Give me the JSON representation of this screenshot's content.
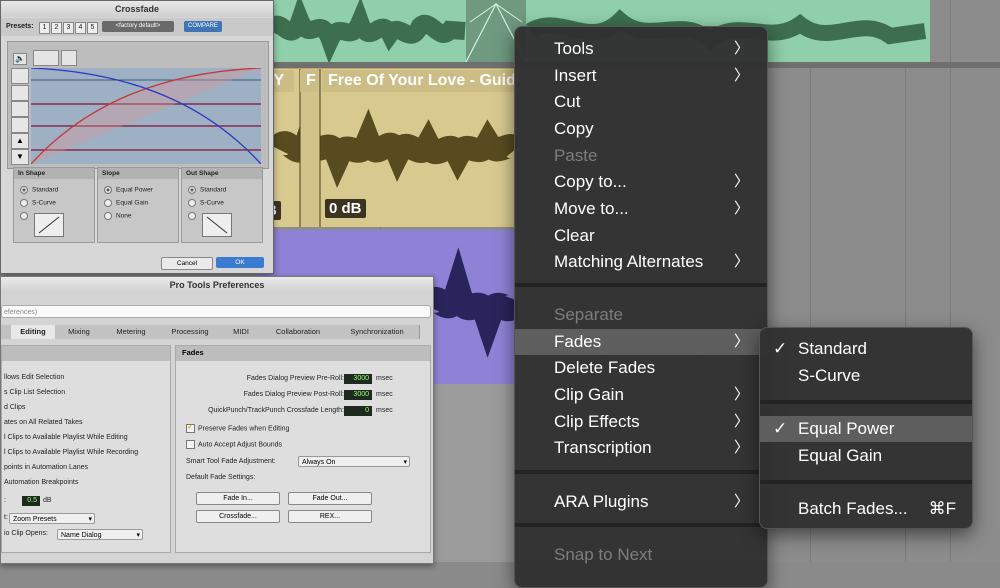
{
  "crossfade": {
    "title": "Crossfade",
    "presets_label": "Presets:",
    "preset_numbers": [
      "1",
      "2",
      "3",
      "4",
      "5"
    ],
    "preset_field": "<factory default>",
    "compare": "COMPARE",
    "in_shape": {
      "title": "In Shape",
      "options": [
        "Standard",
        "S-Curve"
      ],
      "selected": "Standard"
    },
    "slope": {
      "title": "Slope",
      "options": [
        "Equal Power",
        "Equal Gain",
        "None"
      ],
      "selected": "Equal Power"
    },
    "out_shape": {
      "title": "Out Shape",
      "options": [
        "Standard",
        "S-Curve"
      ],
      "selected": "Standard"
    },
    "cancel": "Cancel",
    "ok": "OK"
  },
  "timeline": {
    "clip_title_partial": "f Y",
    "clip_marker": "F",
    "clip_title": "Free Of Your Love - Guid",
    "gain_label": "0 dB",
    "gain_partial": "B"
  },
  "prefs": {
    "title": "Pro Tools Preferences",
    "search_placeholder": "eferences)",
    "tabs": [
      "Editing",
      "Mixing",
      "Metering",
      "Processing",
      "MIDI",
      "Collaboration",
      "Synchronization"
    ],
    "active_tab": "Editing",
    "left_items": [
      "llows Edit Selection",
      "s Clip List Selection",
      "d Clips",
      "ates on All Related Takes",
      "l Clips to Available Playlist While Editing",
      "l Clips to Available Playlist While Recording",
      "points in Automation Lanes",
      "Automation Breakpoints"
    ],
    "left_num_label": ":",
    "left_num_value": "0.5",
    "left_num_unit": "dB",
    "left_select1_label": "t:",
    "left_select1_value": "Zoom Presets",
    "left_select2_label": "io Clip Opens:",
    "left_select2_value": "Name Dialog",
    "fades_title": "Fades",
    "preroll_label": "Fades Dialog Preview Pre-Roll:",
    "preroll_value": "3000",
    "postroll_label": "Fades Dialog Preview Post-Roll:",
    "postroll_value": "3000",
    "msec": "msec",
    "crossfade_len_label": "QuickPunch/TrackPunch Crossfade Length:",
    "crossfade_len_value": "0",
    "preserve_fades": "Preserve Fades when Editing",
    "auto_accept": "Auto Accept Adjust Bounds",
    "smart_tool_label": "Smart Tool Fade Adjustment:",
    "smart_tool_value": "Always On",
    "default_fade_settings": "Default Fade Settings:",
    "fade_in": "Fade In...",
    "fade_out": "Fade Out...",
    "crossfade_btn": "Crossfade...",
    "rex_btn": "REX..."
  },
  "menu": {
    "items": [
      {
        "label": "Tools",
        "submenu": true
      },
      {
        "label": "Insert",
        "submenu": true
      },
      {
        "label": "Cut"
      },
      {
        "label": "Copy"
      },
      {
        "label": "Paste",
        "disabled": true
      },
      {
        "label": "Copy to...",
        "submenu": true
      },
      {
        "label": "Move to...",
        "submenu": true
      },
      {
        "label": "Clear"
      },
      {
        "label": "Matching Alternates",
        "submenu": true
      },
      {
        "label": "Separate",
        "disabled": true
      },
      {
        "label": "Fades",
        "submenu": true,
        "highlighted": true
      },
      {
        "label": "Delete Fades"
      },
      {
        "label": "Clip Gain",
        "submenu": true
      },
      {
        "label": "Clip Effects",
        "submenu": true
      },
      {
        "label": "Transcription",
        "submenu": true
      },
      {
        "label": "ARA Plugins",
        "submenu": true
      },
      {
        "label": "Snap to Next",
        "disabled": true
      }
    ],
    "arrow": "〉"
  },
  "submenu": {
    "standard": "Standard",
    "s_curve": "S-Curve",
    "equal_power": "Equal Power",
    "equal_gain": "Equal Gain",
    "batch_fades": "Batch Fades...",
    "batch_shortcut": "⌘F",
    "check": "✓"
  },
  "colors": {
    "green_track": "#8fcfa9",
    "tan_track": "#d8c98f",
    "purple_track": "#8f82d6",
    "menu_bg": "#303030",
    "menu_highlight": "#5e5e5e",
    "accent_blue": "#3b7bd0"
  }
}
